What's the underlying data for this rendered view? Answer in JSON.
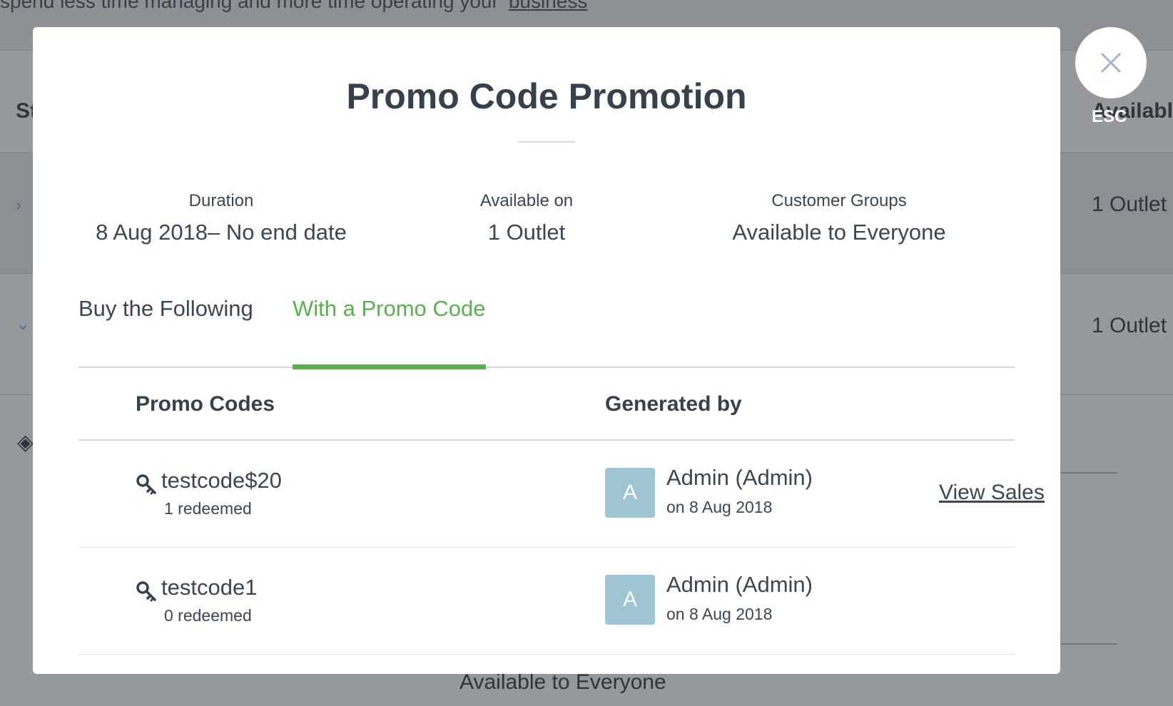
{
  "background": {
    "topbar_text": "spend less time managing and more time operating your",
    "topbar_link": "business",
    "header_left": "St",
    "header_right": "Available",
    "row1_right": "1 Outlet",
    "row2_right": "1 Outlet",
    "bottom_text": "Available to Everyone"
  },
  "close": {
    "esc_label": "ESC"
  },
  "modal": {
    "title": "Promo Code Promotion",
    "summary": {
      "duration_label": "Duration",
      "duration_value": "8 Aug 2018– No end date",
      "available_label": "Available on",
      "available_value": "1 Outlet",
      "groups_label": "Customer Groups",
      "groups_value": "Available to Everyone"
    },
    "tabs": {
      "buy": "Buy the Following",
      "promo": "With a Promo Code",
      "active": "promo"
    },
    "table": {
      "headers": {
        "codes": "Promo Codes",
        "generated": "Generated by"
      },
      "rows": [
        {
          "code": "testcode$20",
          "redeemed": "1 redeemed",
          "avatar": "A",
          "by": "Admin (Admin)",
          "date": "on 8 Aug 2018",
          "action": "View Sales"
        },
        {
          "code": "testcode1",
          "redeemed": "0 redeemed",
          "avatar": "A",
          "by": "Admin (Admin)",
          "date": "on 8 Aug 2018"
        }
      ]
    }
  },
  "colors": {
    "accent_green": "#5cae52",
    "avatar_bg": "#9ec5d1",
    "text": "#3b4650",
    "overlay": "#96999c"
  }
}
